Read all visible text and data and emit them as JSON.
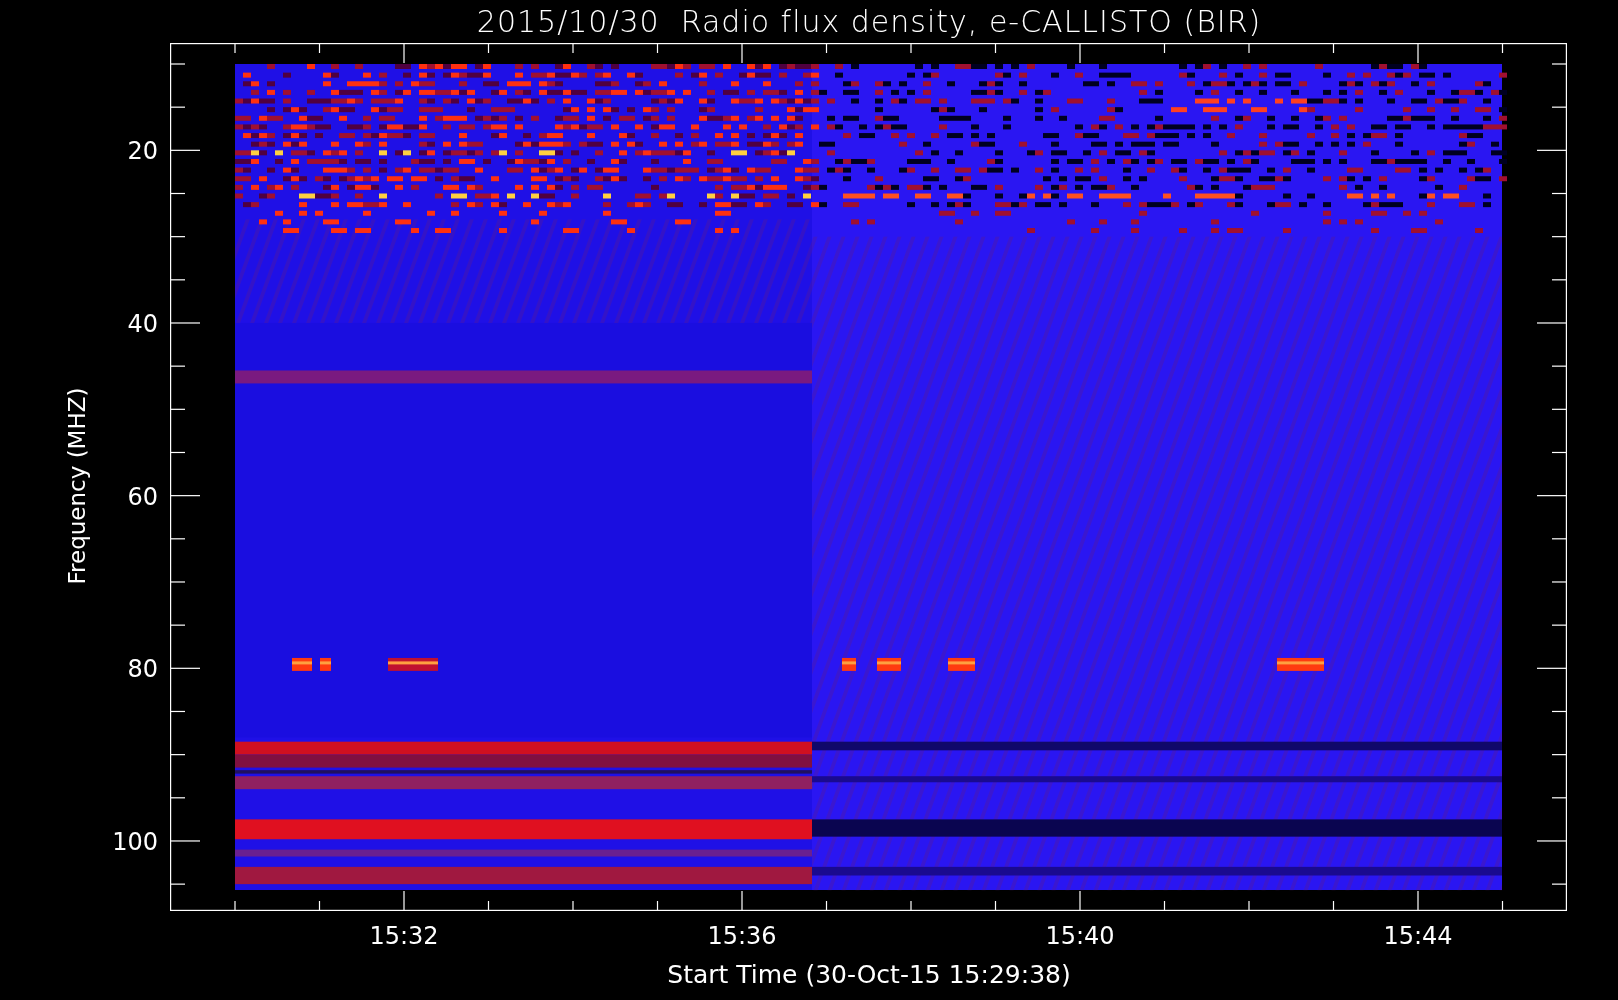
{
  "title": "2015/10/30  Radio flux density, e-CALLISTO (BIR)",
  "ylabel": "Frequency (MHZ)",
  "xlabel": "Start Time (30-Oct-15 15:29:38)",
  "yticks": [
    "20",
    "40",
    "60",
    "80",
    "100"
  ],
  "xticks": [
    "15:32",
    "15:36",
    "15:40",
    "15:44"
  ]
}
